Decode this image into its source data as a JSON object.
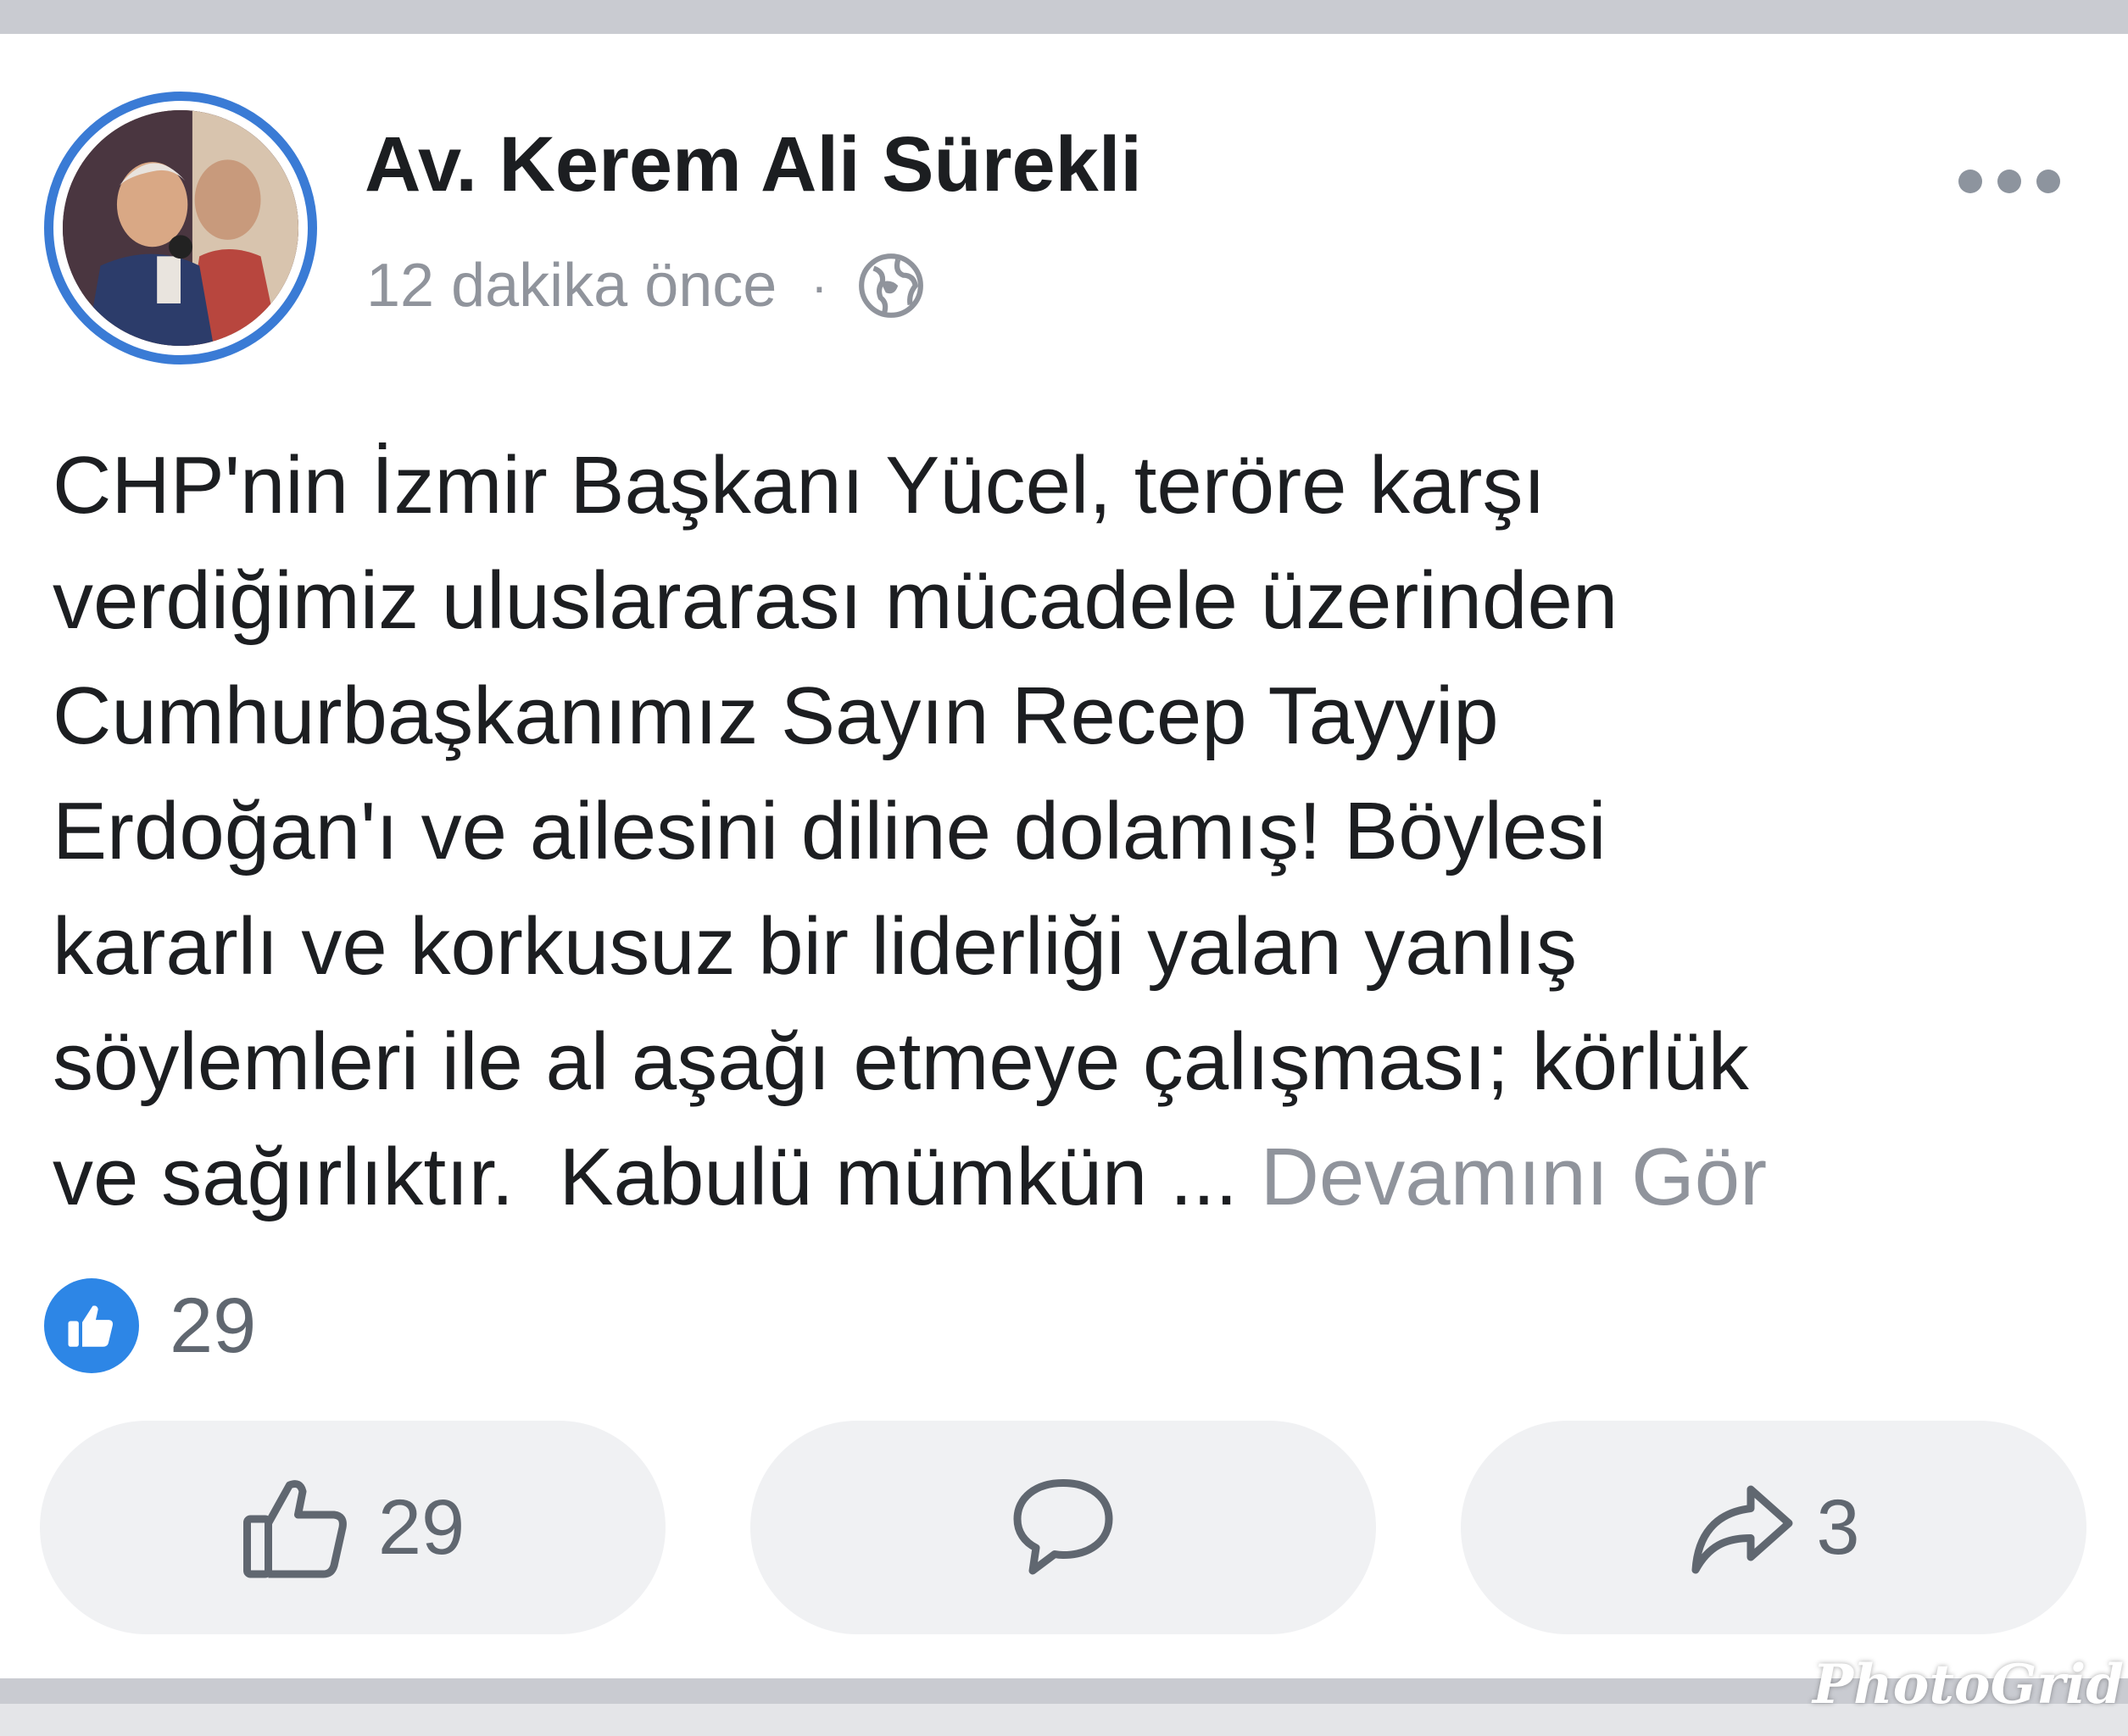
{
  "post": {
    "author": "Av. Kerem Ali Sürekli",
    "timestamp": "12 dakika önce",
    "separator": "·",
    "privacy_icon": "globe-icon",
    "text_lines": [
      "CHP'nin İzmir Başkanı Yücel, teröre karşı",
      "verdiğimiz uluslararası mücadele üzerinden",
      "Cumhurbaşkanımız Sayın Recep Tayyip",
      "Erdoğan'ı ve ailesini diline dolamış! Böylesi",
      "kararlı ve korkusuz bir liderliği yalan yanlış",
      "söylemleri ile al aşağı etmeye çalışması; körlük",
      "ve sağırlıktır.  Kabulü mümkün ... "
    ],
    "see_more": "Devamını Gör"
  },
  "reactions": {
    "icon": "like-reaction-icon",
    "count": "29"
  },
  "actions": {
    "like_count": "29",
    "share_count": "3"
  },
  "watermark": "PhotoGrid",
  "colors": {
    "accent_blue": "#2d86e6",
    "avatar_ring": "#3a7bd5",
    "text": "#1c1e21",
    "muted_text": "#90949c",
    "button_bg": "#f0f1f3"
  }
}
